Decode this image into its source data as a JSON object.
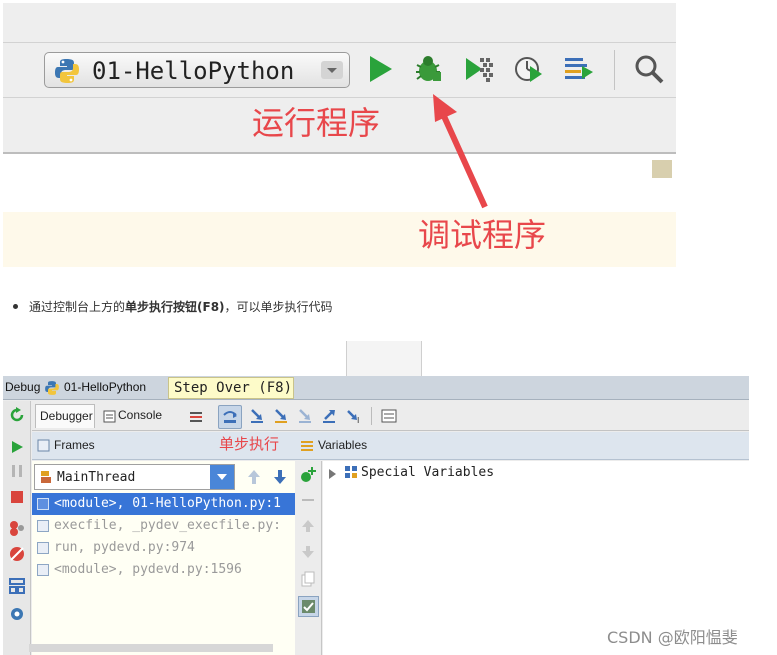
{
  "toolbar": {
    "run_config": "01-HelloPython",
    "icons": [
      "python-icon",
      "run-icon",
      "debug-icon",
      "coverage-icon",
      "profile-icon",
      "concurrency-icon",
      "search-icon"
    ]
  },
  "annotations": {
    "run": "运行程序",
    "debug": "调试程序",
    "step": "单步执行"
  },
  "note": {
    "prefix": "通过控制台上方的",
    "bold": "单步执行按钮(F8)",
    "suffix": "，可以单步执行代码"
  },
  "debug_panel": {
    "title": "Debug",
    "config": "01-HelloPython",
    "tooltip": "Step Over (F8)",
    "tabs": [
      "Debugger",
      "Console"
    ],
    "frames_header": "Frames",
    "variables_header": "Variables",
    "thread": "MainThread",
    "frames": [
      "<module>, 01-HelloPython.py:1",
      "execfile, _pydev_execfile.py:",
      "run, pydevd.py:974",
      "<module>, pydevd.py:1596"
    ],
    "variables": [
      "Special Variables"
    ]
  },
  "watermark": "CSDN @欧阳愠斐",
  "colors": {
    "annotation": "#e8474b",
    "selection": "#3875d7",
    "run_green": "#2aa33b"
  }
}
